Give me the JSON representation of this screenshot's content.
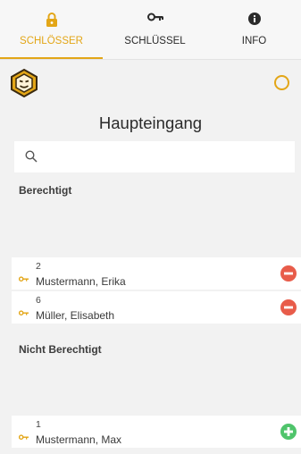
{
  "tabs": [
    {
      "label": "SCHLÖSSER",
      "icon": "lock-icon",
      "active": true
    },
    {
      "label": "SCHLÜSSEL",
      "icon": "key-icon",
      "active": false
    },
    {
      "label": "INFO",
      "icon": "info-icon",
      "active": false
    }
  ],
  "lock": {
    "name": "Haupteingang",
    "logo": "lion-logo-icon",
    "status_icon": "status-ring-icon"
  },
  "search": {
    "placeholder": "",
    "value": "",
    "icon": "search-icon"
  },
  "authorized": {
    "title": "Berechtigt",
    "items": [
      {
        "number": "2",
        "name": "Mustermann, Erika",
        "action": "remove"
      },
      {
        "number": "6",
        "name": "Müller, Elisabeth",
        "action": "remove"
      }
    ]
  },
  "unauthorized": {
    "title": "Nicht Berechtigt",
    "items": [
      {
        "number": "1",
        "name": "Mustermann, Max",
        "action": "add"
      }
    ]
  },
  "colors": {
    "accent": "#e3a617",
    "remove": "#e85c4a",
    "add": "#4fc46b",
    "background": "#f2f2f2"
  }
}
